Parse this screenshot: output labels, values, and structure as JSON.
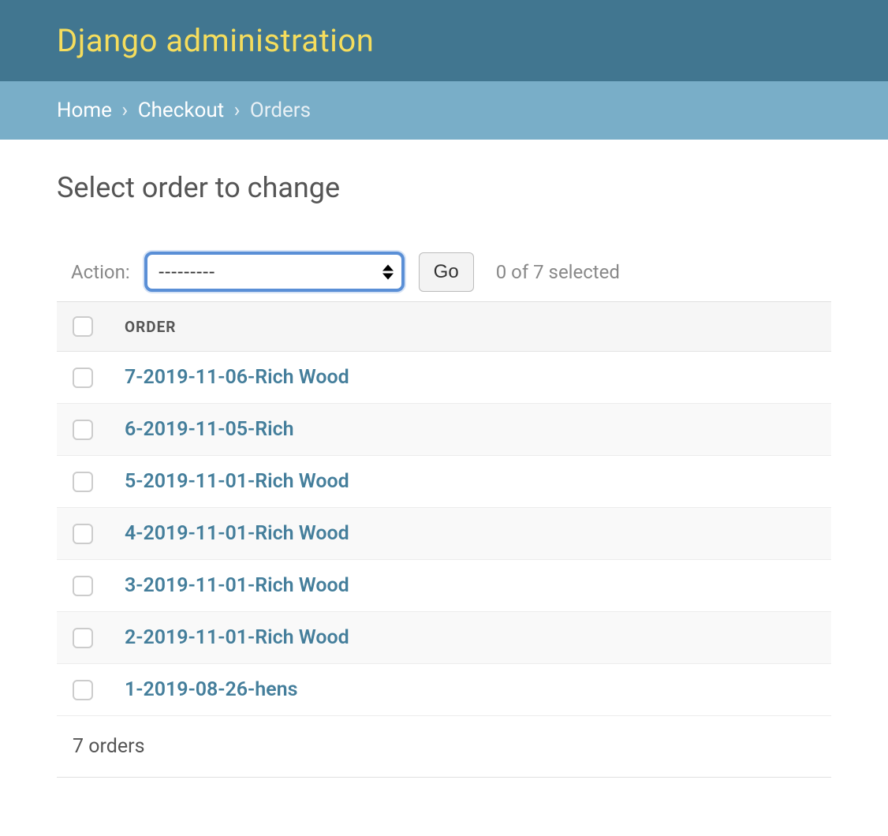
{
  "header": {
    "title": "Django administration"
  },
  "breadcrumbs": {
    "home_label": "Home",
    "app_label": "Checkout",
    "current_label": "Orders",
    "separator": "›"
  },
  "page": {
    "title": "Select order to change"
  },
  "actions": {
    "label": "Action:",
    "select_placeholder": "---------",
    "go_label": "Go",
    "selection_counter": "0 of 7 selected"
  },
  "table": {
    "column_header": "ORDER",
    "rows": [
      {
        "label": "7-2019-11-06-Rich Wood"
      },
      {
        "label": "6-2019-11-05-Rich"
      },
      {
        "label": "5-2019-11-01-Rich Wood"
      },
      {
        "label": "4-2019-11-01-Rich Wood"
      },
      {
        "label": "3-2019-11-01-Rich Wood"
      },
      {
        "label": "2-2019-11-01-Rich Wood"
      },
      {
        "label": "1-2019-08-26-hens"
      }
    ]
  },
  "paginator": {
    "summary": "7 orders"
  }
}
